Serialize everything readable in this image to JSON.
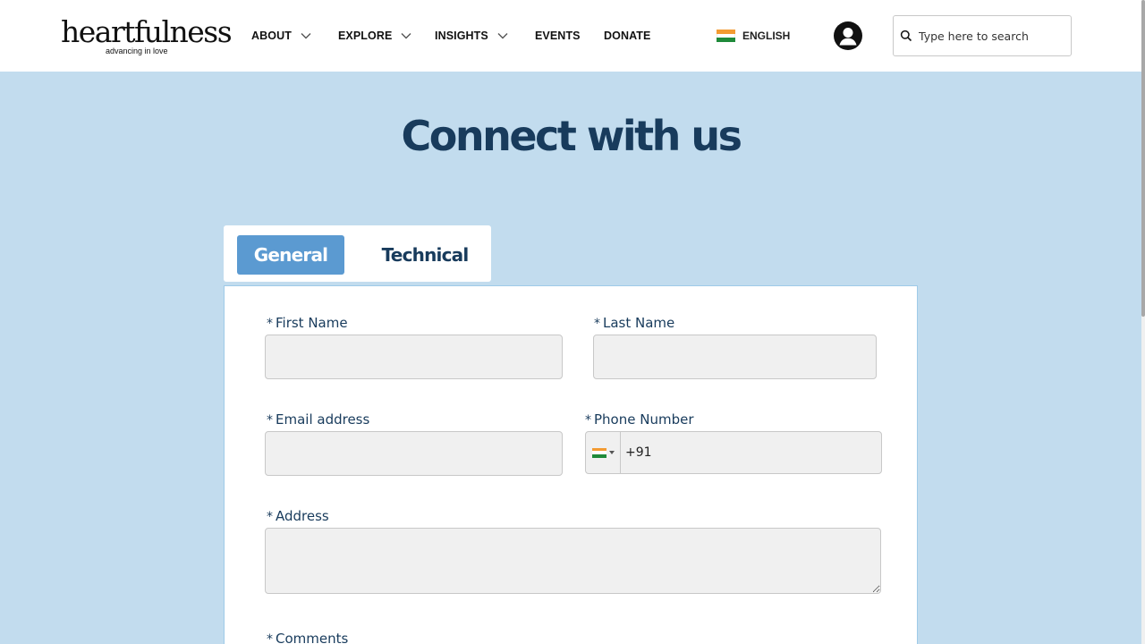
{
  "brand": {
    "name": "heartfulness",
    "tagline": "advancing in love"
  },
  "nav": {
    "about": "ABOUT",
    "explore": "EXPLORE",
    "insights": "INSIGHTS",
    "events": "EVENTS",
    "donate": "DONATE"
  },
  "language": {
    "label": "ENGLISH",
    "flag_colors": [
      "#f39b32",
      "#ffffff",
      "#1f8a3a"
    ]
  },
  "search": {
    "placeholder": "Type here to search",
    "value": ""
  },
  "page": {
    "title": "Connect with us"
  },
  "tabs": [
    {
      "label": "General",
      "active": true
    },
    {
      "label": "Technical",
      "active": false
    }
  ],
  "form": {
    "required_marker": "*",
    "first_name": {
      "label": "First Name",
      "value": ""
    },
    "last_name": {
      "label": "Last Name",
      "value": ""
    },
    "email": {
      "label": "Email address",
      "value": ""
    },
    "phone": {
      "label": "Phone Number",
      "value": "+91"
    },
    "address": {
      "label": "Address",
      "value": ""
    },
    "comments": {
      "label": "Comments"
    }
  },
  "colors": {
    "page_bg": "#c2dcee",
    "title": "#183b5c",
    "active_tab": "#5b9ad1",
    "field_bg": "#f0f0f0"
  }
}
